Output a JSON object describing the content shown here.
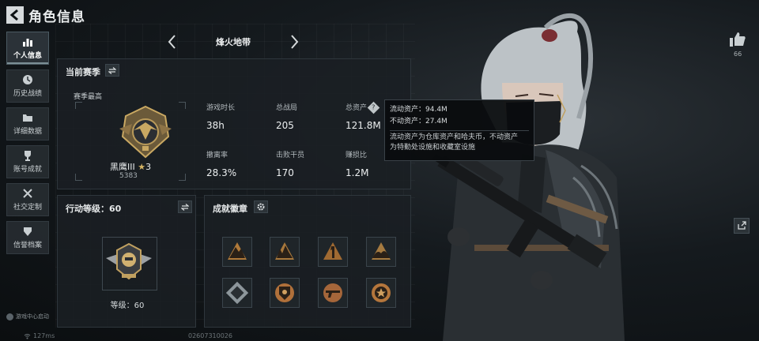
{
  "header": {
    "title": "角色信息"
  },
  "nav": {
    "items": [
      {
        "label": "个人信息",
        "icon": "bar-chart-icon",
        "active": true
      },
      {
        "label": "历史战绩",
        "icon": "clock-icon",
        "active": false
      },
      {
        "label": "详细数据",
        "icon": "folder-icon",
        "active": false
      },
      {
        "label": "账号成就",
        "icon": "trophy-icon",
        "active": false
      },
      {
        "label": "社交定制",
        "icon": "tools-icon",
        "active": false
      },
      {
        "label": "信誉档案",
        "icon": "shield-icon",
        "active": false
      }
    ],
    "game_center": "游戏中心启动"
  },
  "mode": {
    "name": "烽火地带"
  },
  "season": {
    "title": "当前赛季",
    "best_label": "赛季最高",
    "rank_name": "黑鹰III",
    "rank_stars": "3",
    "rank_points": "5383",
    "stats": [
      {
        "label": "游戏时长",
        "value": "38h"
      },
      {
        "label": "总战局",
        "value": "205"
      },
      {
        "label": "总资产",
        "value": "121.8M"
      },
      {
        "label": "撤离率",
        "value": "28.3%"
      },
      {
        "label": "击败干员",
        "value": "170"
      },
      {
        "label": "赚损比",
        "value": "1.2M"
      }
    ]
  },
  "tooltip": {
    "liquid": "流动资产：94.4M",
    "fixed": "不动资产：27.4M",
    "desc_line1": "流动资产为仓库资产和哈夫币，不动资产",
    "desc_line2": "为特勤处设施和收藏室设施"
  },
  "level": {
    "title": "行动等级：60",
    "label": "等级：60"
  },
  "achievements": {
    "title": "成就徽章",
    "badges": [
      {
        "icon": "mountain-badge-icon",
        "color": "#b07a3a"
      },
      {
        "icon": "ruins-badge-icon",
        "color": "#a8783c"
      },
      {
        "icon": "number-one-badge-icon",
        "color": "#a06a32"
      },
      {
        "icon": "hills-badge-icon",
        "color": "#a57a40"
      },
      {
        "icon": "crate-badge-icon",
        "color": "#8d969b"
      },
      {
        "icon": "police-badge-icon",
        "color": "#b0703a"
      },
      {
        "icon": "gun-badge-icon",
        "color": "#a5663a"
      },
      {
        "icon": "star-medal-badge-icon",
        "color": "#b4763c"
      }
    ]
  },
  "social": {
    "likes": "66"
  },
  "status": {
    "ping": "127ms",
    "uid": "02607310026"
  }
}
